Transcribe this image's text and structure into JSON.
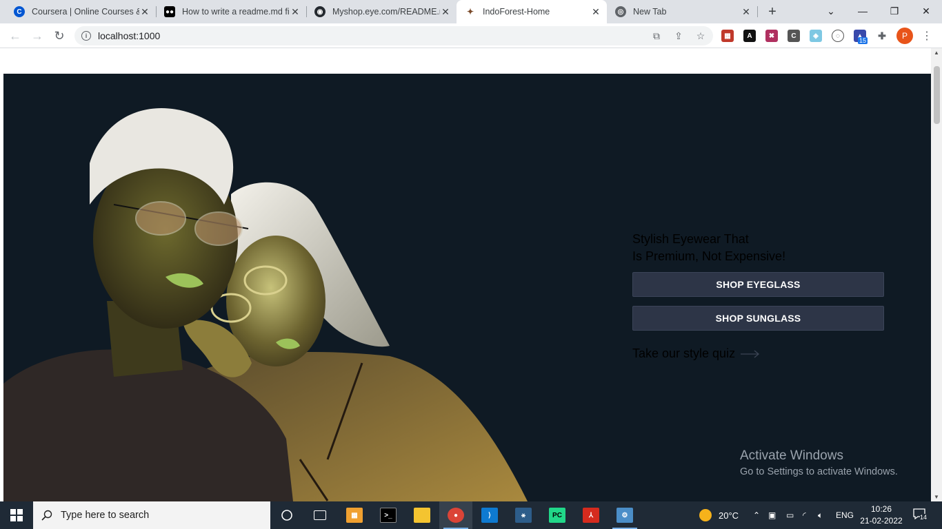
{
  "browser": {
    "tabs": [
      {
        "title": "Coursera | Online Courses & Cr",
        "favicon": "coursera-icon",
        "active": false
      },
      {
        "title": "How to write a readme.md file",
        "favicon": "medium-icon",
        "active": false
      },
      {
        "title": "Myshop.eye.com/README.md",
        "favicon": "github-icon",
        "active": false
      },
      {
        "title": "IndoForest-Home",
        "favicon": "site-icon",
        "active": true
      },
      {
        "title": "New Tab",
        "favicon": "chrome-icon",
        "active": false
      }
    ],
    "url": "localhost:1000",
    "profile_initial": "P",
    "extension_badge": "15"
  },
  "hero": {
    "tagline_line1": "Stylish Eyewear That",
    "tagline_line2": "Is Premium, Not Expensive!",
    "shop_eyeglass_label": "SHOP EYEGLASS",
    "shop_sunglass_label": "SHOP SUNGLASS",
    "quiz_label": "Take our style quiz",
    "background_color": "#0f1a24",
    "button_color": "#2d3547"
  },
  "watermark": {
    "title": "Activate Windows",
    "subtitle": "Go to Settings to activate Windows."
  },
  "taskbar": {
    "search_placeholder": "Type here to search",
    "weather": "20°C",
    "language": "ENG",
    "time": "10:26",
    "date": "21-02-2022",
    "notification_count": "14"
  }
}
